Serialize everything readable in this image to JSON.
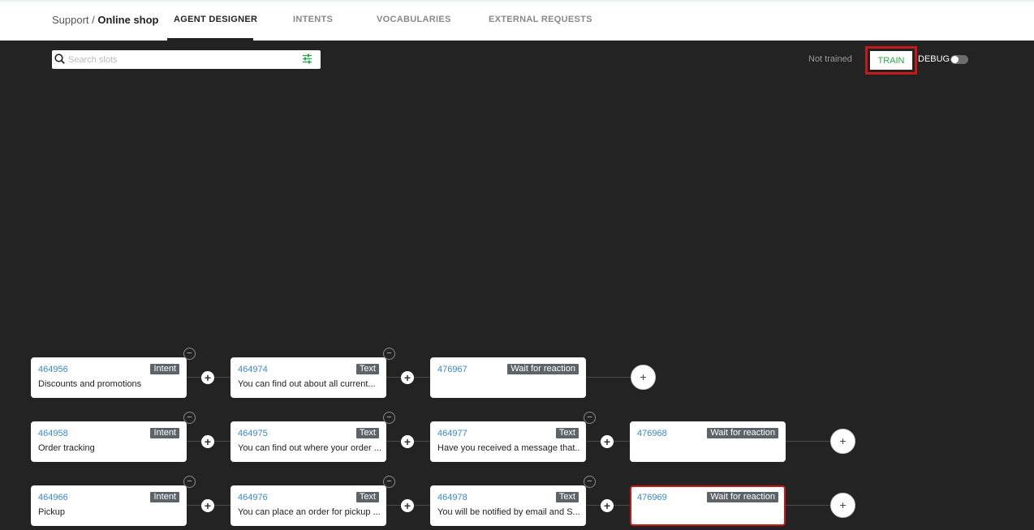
{
  "header": {
    "breadcrumb_parent": "Support /",
    "breadcrumb_current": "Online shop",
    "tabs": [
      {
        "label": "AGENT DESIGNER"
      },
      {
        "label": "INTENTS"
      },
      {
        "label": "VOCABULARIES"
      },
      {
        "label": "EXTERNAL REQUESTS"
      }
    ]
  },
  "toolbar": {
    "search_placeholder": "Search slots",
    "status": "Not trained",
    "train_label": "TRAIN",
    "debug_label": "DEBUG",
    "accent_color": "#2ea84a",
    "highlight_color": "#c41a1a"
  },
  "flows": [
    {
      "cards": [
        {
          "id": "464956",
          "type": "Intent",
          "text": "Discounts and promotions"
        },
        {
          "id": "464974",
          "type": "Text",
          "text": "You can find out about all current..."
        },
        {
          "id": "476967",
          "type": "Wait for reaction",
          "text": ""
        }
      ]
    },
    {
      "cards": [
        {
          "id": "464958",
          "type": "Intent",
          "text": "Order tracking"
        },
        {
          "id": "464975",
          "type": "Text",
          "text": "You can find out where your order ..."
        },
        {
          "id": "464977",
          "type": "Text",
          "text": "Have you received a message that..."
        },
        {
          "id": "476968",
          "type": "Wait for reaction",
          "text": ""
        }
      ]
    },
    {
      "cards": [
        {
          "id": "464966",
          "type": "Intent",
          "text": "Pickup"
        },
        {
          "id": "464976",
          "type": "Text",
          "text": "You can place an order for pickup ..."
        },
        {
          "id": "464978",
          "type": "Text",
          "text": "You will be notified by email and S..."
        },
        {
          "id": "476969",
          "type": "Wait for reaction",
          "text": "",
          "selected": true
        }
      ]
    }
  ],
  "icons": {
    "add": "+",
    "remove": "−"
  }
}
